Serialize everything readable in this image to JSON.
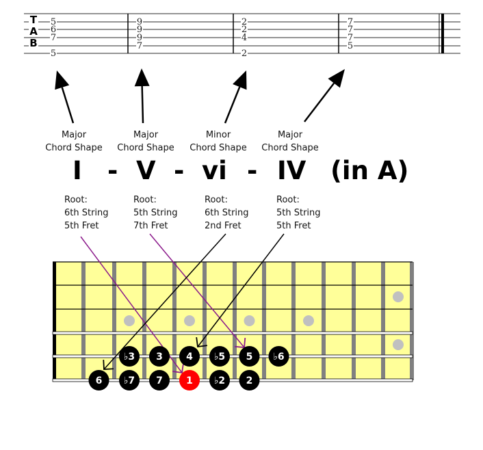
{
  "tab": {
    "clef": [
      "T",
      "A",
      "B"
    ],
    "strings": 6,
    "measures": [
      {
        "notes": [
          {
            "line": 2,
            "fret": "5"
          },
          {
            "line": 3,
            "fret": "6"
          },
          {
            "line": 4,
            "fret": "7"
          },
          {
            "line": 6,
            "fret": "5"
          }
        ]
      },
      {
        "notes": [
          {
            "line": 2,
            "fret": "9"
          },
          {
            "line": 3,
            "fret": "9"
          },
          {
            "line": 4,
            "fret": "9"
          },
          {
            "line": 5,
            "fret": "7"
          }
        ]
      },
      {
        "notes": [
          {
            "line": 2,
            "fret": "2"
          },
          {
            "line": 3,
            "fret": "2"
          },
          {
            "line": 4,
            "fret": "4"
          },
          {
            "line": 6,
            "fret": "2"
          }
        ]
      },
      {
        "notes": [
          {
            "line": 2,
            "fret": "7"
          },
          {
            "line": 3,
            "fret": "7"
          },
          {
            "line": 4,
            "fret": "7"
          },
          {
            "line": 5,
            "fret": "5"
          }
        ]
      }
    ]
  },
  "shape_labels": [
    {
      "line1": "Major",
      "line2": "Chord Shape"
    },
    {
      "line1": "Major",
      "line2": "Chord Shape"
    },
    {
      "line1": "Minor",
      "line2": "Chord Shape"
    },
    {
      "line1": "Major",
      "line2": "Chord Shape"
    }
  ],
  "progression": {
    "chords": [
      "I",
      "V",
      "vi",
      "IV"
    ],
    "separator": "-",
    "key_note": "(in A)"
  },
  "roots": [
    {
      "line1": "Root:",
      "line2": "6th String",
      "line3": "5th Fret"
    },
    {
      "line1": "Root:",
      "line2": "5th String",
      "line3": "7th Fret"
    },
    {
      "line1": "Root:",
      "line2": "6th String",
      "line3": "2nd Fret"
    },
    {
      "line1": "Root:",
      "line2": "5th String",
      "line3": "5th Fret"
    }
  ],
  "fretboard": {
    "frets": 12,
    "strings": 6,
    "inlay_frets": [
      3,
      5,
      7,
      9
    ],
    "double_inlay_fret": 12,
    "notes": [
      {
        "string": 5,
        "fret": 3,
        "label": "♭3",
        "root": false
      },
      {
        "string": 5,
        "fret": 4,
        "label": "3",
        "root": false
      },
      {
        "string": 5,
        "fret": 5,
        "label": "4",
        "root": false
      },
      {
        "string": 5,
        "fret": 6,
        "label": "♭5",
        "root": false
      },
      {
        "string": 5,
        "fret": 7,
        "label": "5",
        "root": false
      },
      {
        "string": 5,
        "fret": 8,
        "label": "♭6",
        "root": false
      },
      {
        "string": 6,
        "fret": 2,
        "label": "6",
        "root": false
      },
      {
        "string": 6,
        "fret": 3,
        "label": "♭7",
        "root": false
      },
      {
        "string": 6,
        "fret": 4,
        "label": "7",
        "root": false
      },
      {
        "string": 6,
        "fret": 5,
        "label": "1",
        "root": true
      },
      {
        "string": 6,
        "fret": 6,
        "label": "♭2",
        "root": false
      },
      {
        "string": 6,
        "fret": 7,
        "label": "2",
        "root": false
      }
    ]
  },
  "colors": {
    "fretboard": "#ffff99",
    "fret_wire": "#808080",
    "inlay": "#c0c0c0",
    "note": "#000000",
    "root_note": "#ff0000",
    "major_root_arrow": "#8b1a8b",
    "minor_root_arrow": "#000000"
  }
}
